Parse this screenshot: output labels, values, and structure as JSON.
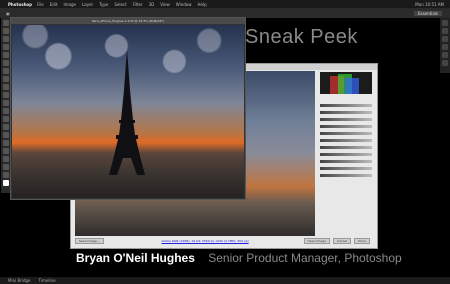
{
  "menubar": {
    "app": "Photoshop",
    "items": [
      "File",
      "Edit",
      "Image",
      "Layer",
      "Type",
      "Select",
      "Filter",
      "3D",
      "View",
      "Window",
      "Help"
    ],
    "right_text": "Mon 10:51 AM"
  },
  "options": {
    "ws_label": "Essentials"
  },
  "overlay": {
    "sneak_title": "Sneak Peek"
  },
  "document": {
    "title": "Paris_iPhone_Hughes-1-2.tif @ 33.3% (RGB/16*)"
  },
  "camera_raw": {
    "save_button": "Save Image...",
    "link": "Adobe RGB (1998); 16 bit; 2560 by 1440 (3.7MP); 300 ppi",
    "open_button": "Open Image",
    "cancel_button": "Cancel",
    "done_button": "Done"
  },
  "presenter": {
    "name": "Bryan O'Neil Hughes",
    "role": "Senior Product Manager, Photoshop"
  },
  "bottombar": {
    "tabs": [
      "Mini Bridge",
      "Timeline"
    ]
  }
}
